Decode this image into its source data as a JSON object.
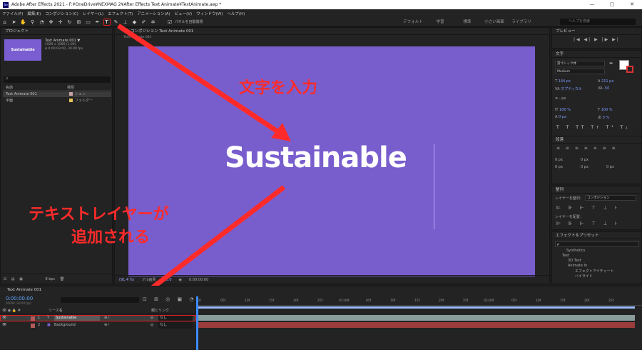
{
  "titlebar": {
    "app_icon": "Ae",
    "title": "Adobe After Effects 2021 - F:¥OneDrive¥NEXMAG 2¥After Effects Text Animate¥TextAnimate.aep *",
    "minimize": "—",
    "maximize": "▢",
    "close": "✕"
  },
  "menu": [
    "ファイル(F)",
    "編集(E)",
    "コンポジション(C)",
    "レイヤー(L)",
    "エフェクト(T)",
    "アニメーション(A)",
    "ビュー(V)",
    "ウィンドウ(W)",
    "ヘルプ(H)"
  ],
  "toolbar": {
    "snap_label": "パネルを自動開閉",
    "workspaces": [
      "デフォルト",
      "学習",
      "標準",
      "小さい画面",
      "ライブラリ"
    ],
    "search_placeholder": "ヘルプを検索"
  },
  "project": {
    "panel_title": "プロジェクト",
    "thumb_text": "Sustainable",
    "comp_name": "Text Animate 001 ▼",
    "comp_size": "1920 x 1080 (1.00)",
    "comp_duration": "Δ 0:00:03:00, 30.00 fps",
    "search_placeholder": "ρ",
    "col_name": "名前",
    "col_type": "種類",
    "rows": [
      {
        "name": "Text Animate 001",
        "type": "ション",
        "color": "#c9a3a3"
      },
      {
        "name": "平面",
        "type": "フォルダー",
        "color": "#e4c35a"
      }
    ],
    "footer_bpc": "8 bpc"
  },
  "comp": {
    "panel_title": "コンポジション Text Animate 001",
    "tab": "Text Animate 001",
    "canvas_color": "#785ecd",
    "canvas_text": "Sustainable",
    "zoom": "(91.4 %)",
    "resolution": "フル画質",
    "exposure": "+0.0",
    "timecode": "0:00:00:00"
  },
  "annotations": {
    "input_text": "文字を入力",
    "layer_added_1": "テキストレイヤーが",
    "layer_added_2": "追加される",
    "color": "#ff2b2b"
  },
  "preview": {
    "panel_title": "プレビュー",
    "controls": "|◀ ◀| ▶ |▶ ▶|"
  },
  "character": {
    "panel_title": "文字",
    "font": "游ゴシック体",
    "style": "Medium",
    "size": "144 px",
    "leading": "211 px",
    "kerning": "オプティカル",
    "tracking": "-50",
    "stroke_unit": "- px",
    "vscale": "100 %",
    "hscale": "100 %",
    "baseline": "0 px",
    "tsume": "0 %",
    "styles": [
      "T",
      "T",
      "TT",
      "Tт",
      "T¹",
      "T₁"
    ]
  },
  "paragraph": {
    "panel_title": "段落",
    "indent_values": [
      "0 px",
      "0 px",
      "0 px",
      "0 px",
      "0 px"
    ]
  },
  "align": {
    "panel_title": "整列",
    "align_to_label": "レイヤーを整列：",
    "align_to_value": "コンポジション",
    "distribute_label": "レイヤーを配置："
  },
  "effects": {
    "panel_title": "エフェクト＆プリセット",
    "search_placeholder": "ρ",
    "tree": [
      "Synthetics",
      "Text",
      "3D Text",
      "Animate In",
      "エフェクトアイチャート",
      "ハイライト"
    ]
  },
  "timeline": {
    "panel_title": "Text Animate 001",
    "timecode": "0:00:00:00",
    "frames": "00000 (30.00 fps)",
    "ruler": [
      "0f",
      "05f",
      "10f",
      "15f",
      "20f",
      "25f",
      "01:00f",
      "05f",
      "10f",
      "15f",
      "20f",
      "25f",
      "02:00f",
      "05f",
      "10f",
      "15f",
      "20f",
      "25f"
    ],
    "col_source": "ソース名",
    "col_parent": "親とリンク",
    "layers": [
      {
        "num": "1",
        "type": "T",
        "name": "Sustainable",
        "parent": "なし",
        "color": "#b35a5a"
      },
      {
        "num": "2",
        "type": "■",
        "name": "Background",
        "parent": "なし",
        "color": "#b35a5a"
      }
    ]
  }
}
